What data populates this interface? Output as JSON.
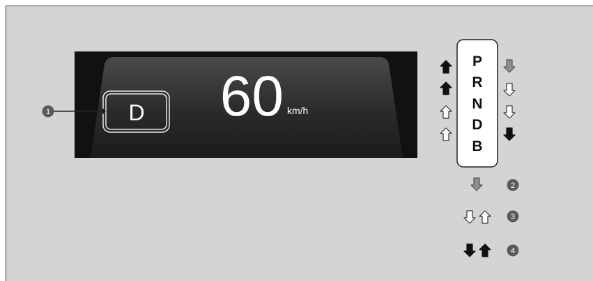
{
  "display": {
    "gear": "D",
    "speed": "60",
    "unit": "km/h",
    "callout": "1"
  },
  "gear_selector": {
    "positions": [
      "P",
      "R",
      "N",
      "D",
      "B"
    ]
  },
  "legend": [
    {
      "number": "2"
    },
    {
      "number": "3"
    },
    {
      "number": "4"
    }
  ],
  "colors": {
    "background": "#d4d4d4",
    "display_bg": "#111111",
    "arrow_dark": "#111111",
    "arrow_gray": "#8e8e8e",
    "arrow_white": "#ffffff",
    "badge": "#5a5a5a"
  }
}
